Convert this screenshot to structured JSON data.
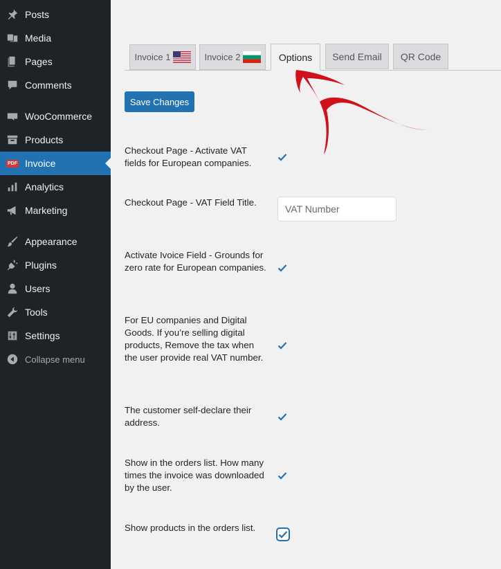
{
  "sidebar": {
    "items": [
      {
        "label": "Posts",
        "icon": "pin-icon"
      },
      {
        "label": "Media",
        "icon": "media-icon"
      },
      {
        "label": "Pages",
        "icon": "pages-icon"
      },
      {
        "label": "Comments",
        "icon": "comments-icon"
      },
      {
        "label": "WooCommerce",
        "icon": "woo-icon"
      },
      {
        "label": "Products",
        "icon": "archive-icon"
      },
      {
        "label": "Invoice",
        "icon": "pdf-icon",
        "active": true
      },
      {
        "label": "Analytics",
        "icon": "bar-chart-icon"
      },
      {
        "label": "Marketing",
        "icon": "megaphone-icon"
      },
      {
        "label": "Appearance",
        "icon": "brush-icon"
      },
      {
        "label": "Plugins",
        "icon": "plug-icon"
      },
      {
        "label": "Users",
        "icon": "user-icon"
      },
      {
        "label": "Tools",
        "icon": "wrench-icon"
      },
      {
        "label": "Settings",
        "icon": "sliders-icon"
      }
    ],
    "collapse_label": "Collapse menu",
    "pdf_badge": "PDF"
  },
  "tabs": [
    {
      "label": "Invoice 1",
      "flag": "us"
    },
    {
      "label": "Invoice 2",
      "flag": "bg"
    },
    {
      "label": "Options",
      "active": true
    },
    {
      "label": "Send Email"
    },
    {
      "label": "QR Code"
    }
  ],
  "save_button": "Save Changes",
  "options": [
    {
      "label": "Checkout Page - Activate VAT fields for European companies.",
      "type": "checkbox",
      "checked": true
    },
    {
      "label": "Checkout Page - VAT Field Title.",
      "type": "text",
      "placeholder": "VAT Number"
    },
    {
      "label": "Activate Ivoice Field - Grounds for zero rate for European companies.",
      "type": "checkbox",
      "checked": true
    },
    {
      "label": "For EU companies and Digital Goods. If you’re selling digital products, Remove the tax when the user provide real VAT number.",
      "type": "checkbox",
      "checked": true
    },
    {
      "label": "The customer self-declare their address.",
      "type": "checkbox",
      "checked": true
    },
    {
      "label": "Show in the orders list. How many times the invoice was downloaded by the user.",
      "type": "checkbox",
      "checked": true
    },
    {
      "label": "Show products in the orders list.",
      "type": "checkbox",
      "checked": true,
      "focused": true
    }
  ],
  "colors": {
    "sidebar_bg": "#1d2327",
    "accent": "#2271b1",
    "arrow": "#d0111b"
  }
}
